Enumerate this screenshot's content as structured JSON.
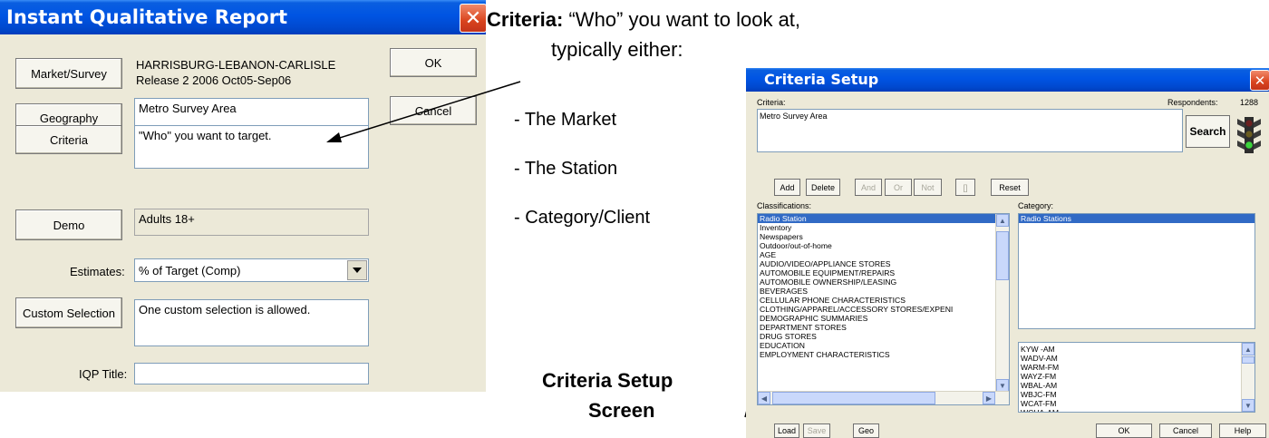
{
  "iqr": {
    "title": "Instant Qualitative Report",
    "market_button": "Market/Survey",
    "market_line1": "HARRISBURG-LEBANON-CARLISLE",
    "market_line2": "Release 2 2006 Oct05-Sep06",
    "ok": "OK",
    "cancel": "Cancel",
    "geography_button": "Geography",
    "geography_value": "Metro Survey Area",
    "criteria_button": "Criteria",
    "criteria_value": "\"Who\" you want to target.",
    "demo_button": "Demo",
    "demo_value": "Adults 18+",
    "estimates_label": "Estimates:",
    "estimates_value": "% of Target (Comp)",
    "custom_button": "Custom Selection",
    "custom_value": "One custom selection is allowed.",
    "iqp_label": "IQP Title:",
    "iqp_value": ""
  },
  "annotations": {
    "criteria_bold": "Criteria:",
    "criteria_text": " “Who” you want to look at,",
    "typically": "typically either:",
    "opt1": "- The Market",
    "opt2": "- The Station",
    "opt3": "- Category/Client",
    "setup_line1": "Criteria Setup",
    "setup_line2": "Screen"
  },
  "setup": {
    "title": "Criteria Setup",
    "criteria_label": "Criteria:",
    "respondents_label": "Respondents:",
    "respondents_value": "1288",
    "criteria_value": "Metro Survey Area",
    "search": "Search",
    "add": "Add",
    "delete": "Delete",
    "and": "And",
    "or": "Or",
    "not": "Not",
    "paren": "[]",
    "reset": "Reset",
    "classifications_label": "Classifications:",
    "category_label": "Category:",
    "classifications": [
      "Radio Station",
      "Inventory",
      "Newspapers",
      "Outdoor/out-of-home",
      "AGE",
      "AUDIO/VIDEO/APPLIANCE STORES",
      "AUTOMOBILE EQUIPMENT/REPAIRS",
      "AUTOMOBILE OWNERSHIP/LEASING",
      "BEVERAGES",
      "CELLULAR PHONE CHARACTERISTICS",
      "CLOTHING/APPAREL/ACCESSORY STORES/EXPENI",
      "DEMOGRAPHIC SUMMARIES",
      "DEPARTMENT STORES",
      "DRUG STORES",
      "EDUCATION",
      "EMPLOYMENT CHARACTERISTICS"
    ],
    "categories": [
      "Radio Stations"
    ],
    "stations": [
      "KYW -AM",
      "WADV-AM",
      "WARM-FM",
      "WAYZ-FM",
      "WBAL-AM",
      "WBJC-FM",
      "WCAT-FM",
      "WCHA-AM"
    ],
    "load": "Load",
    "save": "Save",
    "geo": "Geo",
    "ok": "OK",
    "cancel": "Cancel",
    "help": "Help"
  },
  "colors": {
    "titlebar": "#0054e3",
    "dialog_bg": "#ece9d8",
    "selection": "#316ac5",
    "close": "#d9441e"
  }
}
